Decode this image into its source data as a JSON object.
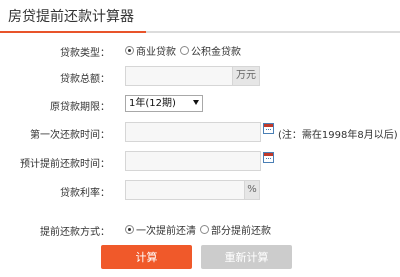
{
  "header": {
    "title": "房贷提前还款计算器"
  },
  "loan_type": {
    "label": "贷款类型：",
    "options": [
      {
        "label": "商业贷款",
        "checked": true
      },
      {
        "label": "公积金贷款",
        "checked": false
      }
    ]
  },
  "loan_total": {
    "label": "贷款总额：",
    "value": "",
    "unit": "万元"
  },
  "loan_term": {
    "label": "原贷款期限：",
    "selected": "1年(12期)"
  },
  "first_repay": {
    "label": "第一次还款时间：",
    "value": "",
    "note": "(注：需在1998年8月以后)"
  },
  "prepay_time": {
    "label": "预计提前还款时间：",
    "value": ""
  },
  "rate": {
    "label": "贷款利率：",
    "value": "",
    "unit": "%"
  },
  "prepay_method": {
    "label": "提前还款方式：",
    "options": [
      {
        "label": "一次提前还清",
        "checked": true
      },
      {
        "label": "部分提前还款",
        "checked": false
      }
    ]
  },
  "buttons": {
    "calculate": "计算",
    "reset": "重新计算"
  },
  "colors": {
    "accent": "#f0592a",
    "disabled": "#cccccc"
  }
}
